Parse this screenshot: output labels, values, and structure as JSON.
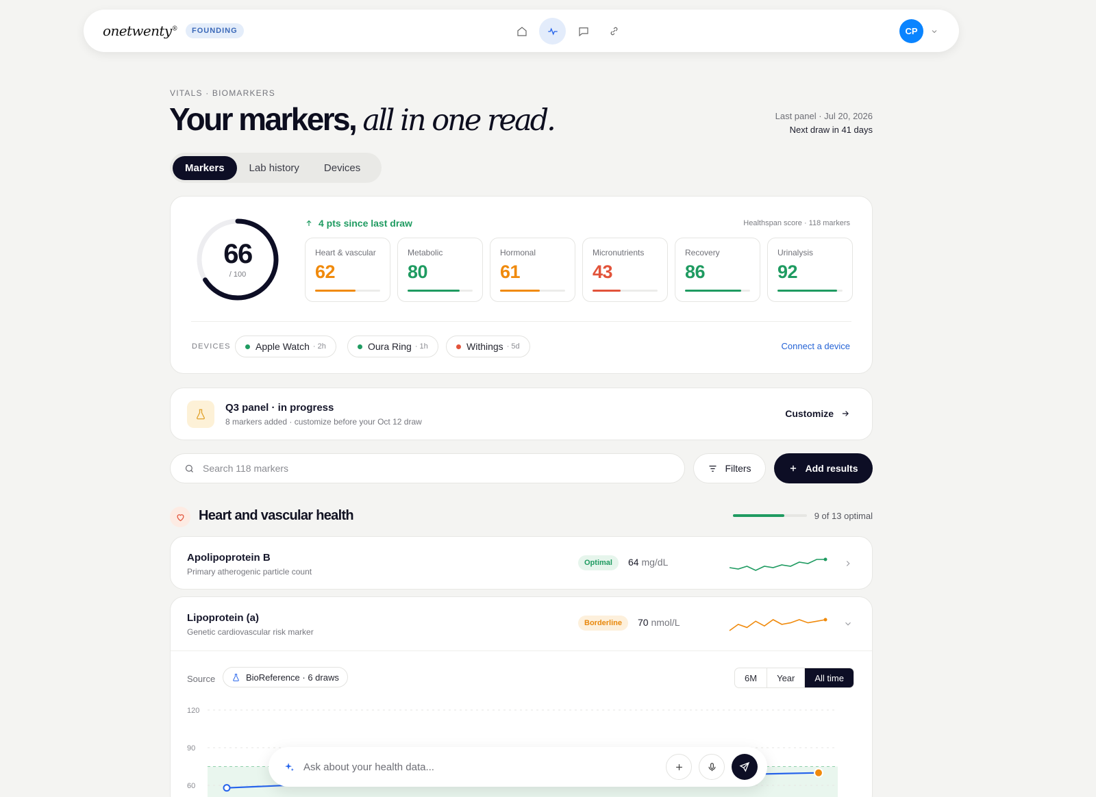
{
  "nav": {
    "logo": "onetwenty",
    "logo_mark": "®",
    "tier": "FOUNDING",
    "icons": [
      "home-icon",
      "activity-icon",
      "chat-icon",
      "link-icon"
    ],
    "avatar_initials": "CP",
    "accent": "#2563eb"
  },
  "header": {
    "eyebrow": "VITALS · BIOMARKERS",
    "title_bold": "Your markers,",
    "title_italic": "all in one read.",
    "last_panel": "Last panel · Jul 20, 2026",
    "next_draw": "Next draw in 41 days"
  },
  "tabs": [
    {
      "label": "Markers",
      "active": true
    },
    {
      "label": "Lab history",
      "active": false
    },
    {
      "label": "Devices",
      "active": false
    }
  ],
  "score": {
    "value": "66",
    "max_label": "/ 100",
    "fraction": 0.66,
    "delta": "4 pts since last draw",
    "meta": "Healthspan score · 118 markers",
    "categories": [
      {
        "name": "Heart & vascular",
        "value": "62",
        "color": "#f08a0c",
        "fill": 0.62
      },
      {
        "name": "Metabolic",
        "value": "80",
        "color": "#1f9b61",
        "fill": 0.8
      },
      {
        "name": "Hormonal",
        "value": "61",
        "color": "#f08a0c",
        "fill": 0.61
      },
      {
        "name": "Micronutrients",
        "value": "43",
        "color": "#e2533a",
        "fill": 0.43
      },
      {
        "name": "Recovery",
        "value": "86",
        "color": "#1f9b61",
        "fill": 0.86
      },
      {
        "name": "Urinalysis",
        "value": "92",
        "color": "#1f9b61",
        "fill": 0.92
      }
    ],
    "devices_label": "DEVICES",
    "devices": [
      {
        "name": "Apple Watch",
        "ago": "· 2h",
        "color": "#1f9b61"
      },
      {
        "name": "Oura Ring",
        "ago": "· 1h",
        "color": "#1f9b61"
      },
      {
        "name": "Withings",
        "ago": "· 5d",
        "color": "#e2533a"
      }
    ],
    "connect": "Connect a device"
  },
  "panel": {
    "title": "Q3 panel · in progress",
    "subtitle": "8 markers added · customize before your Oct 12 draw",
    "action": "Customize"
  },
  "search": {
    "placeholder": "Search 118 markers",
    "filters": "Filters",
    "add": "Add results"
  },
  "section": {
    "title": "Heart and vascular health",
    "count": "9 of 13 optimal",
    "optimal_fraction": 0.69
  },
  "markers": [
    {
      "name": "Apolipoprotein B",
      "desc": "Primary atherogenic particle count",
      "status": "Optimal",
      "status_bg": "#e6f5ec",
      "status_color": "#1f9b61",
      "value": "64",
      "unit": "mg/dL",
      "spark": [
        40,
        39,
        41,
        38,
        41,
        40,
        42,
        41,
        44,
        43,
        46,
        46
      ],
      "spark_color": "#1f9b61"
    },
    {
      "name": "Lipoprotein (a)",
      "desc": "Genetic cardiovascular risk marker",
      "status": "Borderline",
      "status_bg": "#fdf0dc",
      "status_color": "#e8880c",
      "value": "70",
      "unit": "nmol/L",
      "spark": [
        66,
        70,
        68,
        72,
        69,
        73,
        70,
        71,
        73,
        71,
        72,
        73
      ],
      "spark_color": "#f08a0c"
    }
  ],
  "detail": {
    "source_label": "Source",
    "source": "BioReference · 6 draws",
    "ranges": [
      {
        "label": "6M",
        "active": false
      },
      {
        "label": "Year",
        "active": false
      },
      {
        "label": "All time",
        "active": true
      }
    ]
  },
  "chart_data": {
    "type": "line",
    "ylim": [
      60,
      120
    ],
    "yticks": [
      "120",
      "90",
      "60"
    ],
    "optimal_band_max": 75,
    "series": [
      {
        "values": [
          58,
          62,
          64,
          66,
          68,
          70
        ],
        "color": "#2563eb"
      }
    ]
  },
  "ask": {
    "placeholder": "Ask about your health data..."
  }
}
